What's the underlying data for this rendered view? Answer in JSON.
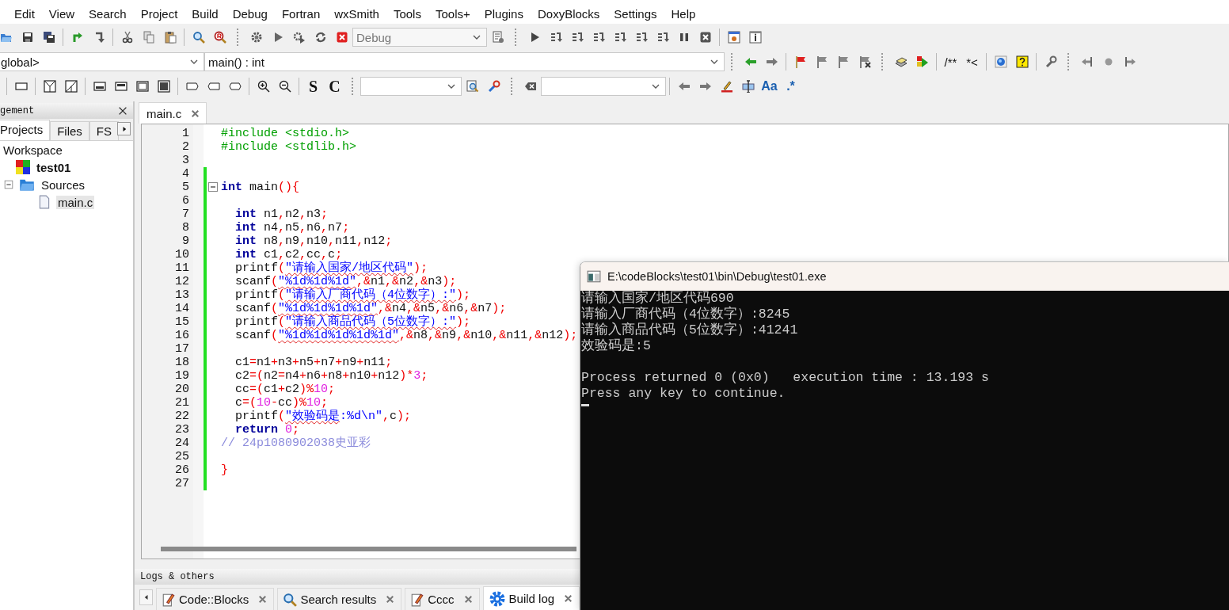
{
  "menu_bar": {
    "items": [
      "Edit",
      "View",
      "Search",
      "Project",
      "Build",
      "Debug",
      "Fortran",
      "wxSmith",
      "Tools",
      "Tools+",
      "Plugins",
      "DoxyBlocks",
      "Settings",
      "Help"
    ]
  },
  "toolbar": {
    "build_target": {
      "value": "Debug",
      "disabled": true
    },
    "scope": "global>",
    "function": "main() : int",
    "glyph_buttons": [
      "S",
      "C",
      "/**",
      "*<",
      "Aa",
      ".*"
    ]
  },
  "management": {
    "title": "gement",
    "tabs": [
      {
        "label": "Projects",
        "selected": true
      },
      {
        "label": "Files",
        "selected": false
      },
      {
        "label": "FS",
        "selected": false
      }
    ],
    "tree": [
      {
        "label": "Workspace",
        "selected": false,
        "children": [
          {
            "label": "test01",
            "kind": "project",
            "selected": false,
            "children": [
              {
                "label": "Sources",
                "kind": "folder",
                "selected": false,
                "children": [
                  {
                    "label": "main.c",
                    "kind": "file",
                    "selected": true
                  }
                ]
              }
            ]
          }
        ]
      }
    ]
  },
  "editor": {
    "tabs": [
      {
        "label": "main.c",
        "selected": true
      }
    ],
    "lines": [
      {
        "number": "1",
        "changed": false,
        "fold_point": false,
        "indented": false,
        "tokens": [
          {
            "kind": "pre",
            "text": "#include <stdio.h>"
          }
        ]
      },
      {
        "number": "2",
        "changed": false,
        "fold_point": false,
        "indented": false,
        "tokens": [
          {
            "kind": "pre",
            "text": "#include <stdlib.h>"
          }
        ]
      },
      {
        "number": "3",
        "changed": false,
        "fold_point": false
      },
      {
        "number": "4",
        "changed": true,
        "fold_point": false
      },
      {
        "number": "5",
        "changed": true,
        "fold_point": true,
        "indented": false,
        "tokens": [
          {
            "kind": "kw",
            "text": "int"
          },
          {
            "kind": "id",
            "text": " main"
          },
          {
            "kind": "op",
            "text": "(){"
          }
        ]
      },
      {
        "number": "6",
        "changed": true,
        "fold_point": false
      },
      {
        "number": "7",
        "changed": true,
        "fold_point": false,
        "indented": true,
        "tokens": [
          {
            "kind": "kw",
            "text": "int"
          },
          {
            "kind": "id",
            "text": " n1"
          },
          {
            "kind": "op",
            "text": ","
          },
          {
            "kind": "id",
            "text": "n2"
          },
          {
            "kind": "op",
            "text": ","
          },
          {
            "kind": "id",
            "text": "n3"
          },
          {
            "kind": "op",
            "text": ";"
          }
        ]
      },
      {
        "number": "8",
        "changed": true,
        "fold_point": false,
        "indented": true,
        "tokens": [
          {
            "kind": "kw",
            "text": "int"
          },
          {
            "kind": "id",
            "text": " n4"
          },
          {
            "kind": "op",
            "text": ","
          },
          {
            "kind": "id",
            "text": "n5"
          },
          {
            "kind": "op",
            "text": ","
          },
          {
            "kind": "id",
            "text": "n6"
          },
          {
            "kind": "op",
            "text": ","
          },
          {
            "kind": "id",
            "text": "n7"
          },
          {
            "kind": "op",
            "text": ";"
          }
        ]
      },
      {
        "number": "9",
        "changed": true,
        "fold_point": false,
        "indented": true,
        "tokens": [
          {
            "kind": "kw",
            "text": "int"
          },
          {
            "kind": "id",
            "text": " n8"
          },
          {
            "kind": "op",
            "text": ","
          },
          {
            "kind": "id",
            "text": "n9"
          },
          {
            "kind": "op",
            "text": ","
          },
          {
            "kind": "id",
            "text": "n10"
          },
          {
            "kind": "op",
            "text": ","
          },
          {
            "kind": "id",
            "text": "n11"
          },
          {
            "kind": "op",
            "text": ","
          },
          {
            "kind": "id",
            "text": "n12"
          },
          {
            "kind": "op",
            "text": ";"
          }
        ]
      },
      {
        "number": "10",
        "changed": true,
        "fold_point": false,
        "indented": true,
        "tokens": [
          {
            "kind": "kw",
            "text": "int"
          },
          {
            "kind": "id",
            "text": " c1"
          },
          {
            "kind": "op",
            "text": ","
          },
          {
            "kind": "id",
            "text": "c2"
          },
          {
            "kind": "op",
            "text": ","
          },
          {
            "kind": "id",
            "text": "cc"
          },
          {
            "kind": "op",
            "text": ","
          },
          {
            "kind": "id",
            "text": "c"
          },
          {
            "kind": "op",
            "text": ";"
          }
        ]
      },
      {
        "number": "11",
        "changed": true,
        "fold_point": false,
        "indented": true,
        "tokens": [
          {
            "kind": "id",
            "text": "printf"
          },
          {
            "kind": "op",
            "text": "("
          },
          {
            "kind": "flag",
            "text": "\"请输入国家/地区代码\""
          },
          {
            "kind": "op",
            "text": ");"
          }
        ]
      },
      {
        "number": "12",
        "changed": true,
        "fold_point": false,
        "indented": true,
        "tokens": [
          {
            "kind": "id",
            "text": "scanf"
          },
          {
            "kind": "op",
            "text": "("
          },
          {
            "kind": "flag",
            "text": "\"%1d%1d%1d\""
          },
          {
            "kind": "op",
            "text": ",&"
          },
          {
            "kind": "id",
            "text": "n1"
          },
          {
            "kind": "op",
            "text": ",&"
          },
          {
            "kind": "id",
            "text": "n2"
          },
          {
            "kind": "op",
            "text": ",&"
          },
          {
            "kind": "id",
            "text": "n3"
          },
          {
            "kind": "op",
            "text": ");"
          }
        ]
      },
      {
        "number": "13",
        "changed": true,
        "fold_point": false,
        "indented": true,
        "tokens": [
          {
            "kind": "id",
            "text": "printf"
          },
          {
            "kind": "op",
            "text": "("
          },
          {
            "kind": "flag",
            "text": "\"请输入厂商代码（4位数字）:\""
          },
          {
            "kind": "op",
            "text": ");"
          }
        ]
      },
      {
        "number": "14",
        "changed": true,
        "fold_point": false,
        "indented": true,
        "tokens": [
          {
            "kind": "id",
            "text": "scanf"
          },
          {
            "kind": "op",
            "text": "("
          },
          {
            "kind": "flag",
            "text": "\"%1d%1d%1d%1d\""
          },
          {
            "kind": "op",
            "text": ",&"
          },
          {
            "kind": "id",
            "text": "n4"
          },
          {
            "kind": "op",
            "text": ",&"
          },
          {
            "kind": "id",
            "text": "n5"
          },
          {
            "kind": "op",
            "text": ",&"
          },
          {
            "kind": "id",
            "text": "n6"
          },
          {
            "kind": "op",
            "text": ",&"
          },
          {
            "kind": "id",
            "text": "n7"
          },
          {
            "kind": "op",
            "text": ");"
          }
        ]
      },
      {
        "number": "15",
        "changed": true,
        "fold_point": false,
        "indented": true,
        "tokens": [
          {
            "kind": "id",
            "text": "printf"
          },
          {
            "kind": "op",
            "text": "("
          },
          {
            "kind": "flag",
            "text": "\"请输入商品代码（5位数字）:\""
          },
          {
            "kind": "op",
            "text": ");"
          }
        ]
      },
      {
        "number": "16",
        "changed": true,
        "fold_point": false,
        "indented": true,
        "tokens": [
          {
            "kind": "id",
            "text": "scanf"
          },
          {
            "kind": "op",
            "text": "("
          },
          {
            "kind": "flag",
            "text": "\"%1d%1d%1d%1d%1d\""
          },
          {
            "kind": "op",
            "text": ",&"
          },
          {
            "kind": "id",
            "text": "n8"
          },
          {
            "kind": "op",
            "text": ",&"
          },
          {
            "kind": "id",
            "text": "n9"
          },
          {
            "kind": "op",
            "text": ",&"
          },
          {
            "kind": "id",
            "text": "n10"
          },
          {
            "kind": "op",
            "text": ",&"
          },
          {
            "kind": "id",
            "text": "n11"
          },
          {
            "kind": "op",
            "text": ",&"
          },
          {
            "kind": "id",
            "text": "n12"
          },
          {
            "kind": "op",
            "text": ");"
          }
        ]
      },
      {
        "number": "17",
        "changed": true,
        "fold_point": false
      },
      {
        "number": "18",
        "changed": true,
        "fold_point": false,
        "indented": true,
        "tokens": [
          {
            "kind": "id",
            "text": "c1"
          },
          {
            "kind": "op",
            "text": "="
          },
          {
            "kind": "id",
            "text": "n1"
          },
          {
            "kind": "op",
            "text": "+"
          },
          {
            "kind": "id",
            "text": "n3"
          },
          {
            "kind": "op",
            "text": "+"
          },
          {
            "kind": "id",
            "text": "n5"
          },
          {
            "kind": "op",
            "text": "+"
          },
          {
            "kind": "id",
            "text": "n7"
          },
          {
            "kind": "op",
            "text": "+"
          },
          {
            "kind": "id",
            "text": "n9"
          },
          {
            "kind": "op",
            "text": "+"
          },
          {
            "kind": "id",
            "text": "n11"
          },
          {
            "kind": "op",
            "text": ";"
          }
        ]
      },
      {
        "number": "19",
        "changed": true,
        "fold_point": false,
        "indented": true,
        "tokens": [
          {
            "kind": "id",
            "text": "c2"
          },
          {
            "kind": "op",
            "text": "=("
          },
          {
            "kind": "id",
            "text": "n2"
          },
          {
            "kind": "op",
            "text": "="
          },
          {
            "kind": "id",
            "text": "n4"
          },
          {
            "kind": "op",
            "text": "+"
          },
          {
            "kind": "id",
            "text": "n6"
          },
          {
            "kind": "op",
            "text": "+"
          },
          {
            "kind": "id",
            "text": "n8"
          },
          {
            "kind": "op",
            "text": "+"
          },
          {
            "kind": "id",
            "text": "n10"
          },
          {
            "kind": "op",
            "text": "+"
          },
          {
            "kind": "id",
            "text": "n12"
          },
          {
            "kind": "op",
            "text": ")*"
          },
          {
            "kind": "num",
            "text": "3"
          },
          {
            "kind": "op",
            "text": ";"
          }
        ]
      },
      {
        "number": "20",
        "changed": true,
        "fold_point": false,
        "indented": true,
        "tokens": [
          {
            "kind": "id",
            "text": "cc"
          },
          {
            "kind": "op",
            "text": "=("
          },
          {
            "kind": "id",
            "text": "c1"
          },
          {
            "kind": "op",
            "text": "+"
          },
          {
            "kind": "id",
            "text": "c2"
          },
          {
            "kind": "op",
            "text": ")%"
          },
          {
            "kind": "num",
            "text": "10"
          },
          {
            "kind": "op",
            "text": ";"
          }
        ]
      },
      {
        "number": "21",
        "changed": true,
        "fold_point": false,
        "indented": true,
        "tokens": [
          {
            "kind": "id",
            "text": "c"
          },
          {
            "kind": "op",
            "text": "=("
          },
          {
            "kind": "num",
            "text": "10"
          },
          {
            "kind": "op",
            "text": "-"
          },
          {
            "kind": "id",
            "text": "cc"
          },
          {
            "kind": "op",
            "text": ")%"
          },
          {
            "kind": "num",
            "text": "10"
          },
          {
            "kind": "op",
            "text": ";"
          }
        ]
      },
      {
        "number": "22",
        "changed": true,
        "fold_point": false,
        "indented": true,
        "tokens": [
          {
            "kind": "id",
            "text": "printf"
          },
          {
            "kind": "op",
            "text": "("
          },
          {
            "kind": "flag",
            "text": "\"效验码是"
          },
          {
            "kind": "str",
            "text": ":%d\\n\""
          },
          {
            "kind": "op",
            "text": ","
          },
          {
            "kind": "id",
            "text": "c"
          },
          {
            "kind": "op",
            "text": ");"
          }
        ]
      },
      {
        "number": "23",
        "changed": true,
        "fold_point": false,
        "indented": true,
        "tokens": [
          {
            "kind": "kw",
            "text": "return"
          },
          {
            "kind": "num",
            "text": " 0"
          },
          {
            "kind": "op",
            "text": ";"
          }
        ]
      },
      {
        "number": "24",
        "changed": true,
        "fold_point": false,
        "indented": false,
        "tokens": [
          {
            "kind": "com",
            "text": "// 24p1080902038史亚彩"
          }
        ]
      },
      {
        "number": "25",
        "changed": true,
        "fold_point": false
      },
      {
        "number": "26",
        "changed": true,
        "fold_point": false,
        "indented": false,
        "tokens": [
          {
            "kind": "op",
            "text": "}"
          }
        ]
      },
      {
        "number": "27",
        "changed": true,
        "fold_point": false
      }
    ]
  },
  "logs": {
    "title": "Logs & others",
    "tabs": [
      {
        "label": "Code::Blocks",
        "selected": false
      },
      {
        "label": "Search results",
        "selected": false
      },
      {
        "label": "Cccc",
        "selected": false
      },
      {
        "label": "Build log",
        "selected": true
      }
    ]
  },
  "console": {
    "title": "E:\\codeBlocks\\test01\\bin\\Debug\\test01.exe",
    "output": [
      "请输入国家/地区代码690",
      "请输入厂商代码（4位数字）:8245",
      "请输入商品代码（5位数字）:41241",
      "效验码是:5"
    ],
    "status": [
      "Process returned 0 (0x0)   execution time : 13.193 s",
      "Press any key to continue."
    ]
  }
}
